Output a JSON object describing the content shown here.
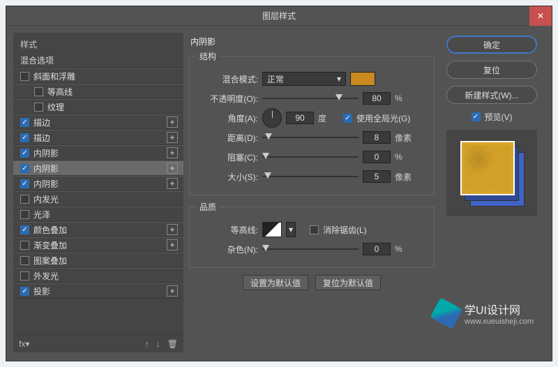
{
  "titlebar": {
    "title": "图层样式"
  },
  "left": {
    "header": "样式",
    "sub": "混合选项",
    "items": [
      {
        "label": "斜面和浮雕",
        "checked": false,
        "add": false,
        "indent": 0
      },
      {
        "label": "等高线",
        "checked": false,
        "add": false,
        "indent": 1
      },
      {
        "label": "纹理",
        "checked": false,
        "add": false,
        "indent": 1
      },
      {
        "label": "描边",
        "checked": true,
        "add": true,
        "indent": 0
      },
      {
        "label": "描边",
        "checked": true,
        "add": true,
        "indent": 0
      },
      {
        "label": "内阴影",
        "checked": true,
        "add": true,
        "indent": 0
      },
      {
        "label": "内阴影",
        "checked": true,
        "add": true,
        "indent": 0,
        "selected": true
      },
      {
        "label": "内阴影",
        "checked": true,
        "add": true,
        "indent": 0
      },
      {
        "label": "内发光",
        "checked": false,
        "add": false,
        "indent": 0
      },
      {
        "label": "光泽",
        "checked": false,
        "add": false,
        "indent": 0
      },
      {
        "label": "颜色叠加",
        "checked": true,
        "add": true,
        "indent": 0
      },
      {
        "label": "渐变叠加",
        "checked": false,
        "add": true,
        "indent": 0
      },
      {
        "label": "图案叠加",
        "checked": false,
        "add": false,
        "indent": 0
      },
      {
        "label": "外发光",
        "checked": false,
        "add": false,
        "indent": 0
      },
      {
        "label": "投影",
        "checked": true,
        "add": true,
        "indent": 0
      }
    ],
    "footer_icons": [
      "fx",
      "up",
      "down",
      "trash"
    ]
  },
  "middle": {
    "section_title": "内阴影",
    "group_structure": "结构",
    "blend_mode_label": "混合模式:",
    "blend_mode_value": "正常",
    "opacity_label": "不透明度(O):",
    "opacity_value": "80",
    "opacity_unit": "%",
    "angle_label": "角度(A):",
    "angle_value": "90",
    "angle_unit": "度",
    "global_light_label": "使用全局光(G)",
    "global_light_checked": true,
    "distance_label": "距离(D):",
    "distance_value": "8",
    "distance_unit": "像素",
    "choke_label": "阻塞(C):",
    "choke_value": "0",
    "choke_unit": "%",
    "size_label": "大小(S):",
    "size_value": "5",
    "size_unit": "像素",
    "group_quality": "品质",
    "contour_label": "等高线:",
    "antialias_label": "消除锯齿(L)",
    "antialias_checked": false,
    "noise_label": "杂色(N):",
    "noise_value": "0",
    "noise_unit": "%",
    "btn_default": "设置为默认值",
    "btn_reset": "复位为默认值",
    "color_swatch": "#c88a1f"
  },
  "right": {
    "ok": "确定",
    "cancel": "复位",
    "new_style": "新建样式(W)...",
    "preview_label": "预览(V)",
    "preview_checked": true
  },
  "watermark": {
    "line1": "学UI设计网",
    "line2": "www.xueuisheji.com"
  }
}
